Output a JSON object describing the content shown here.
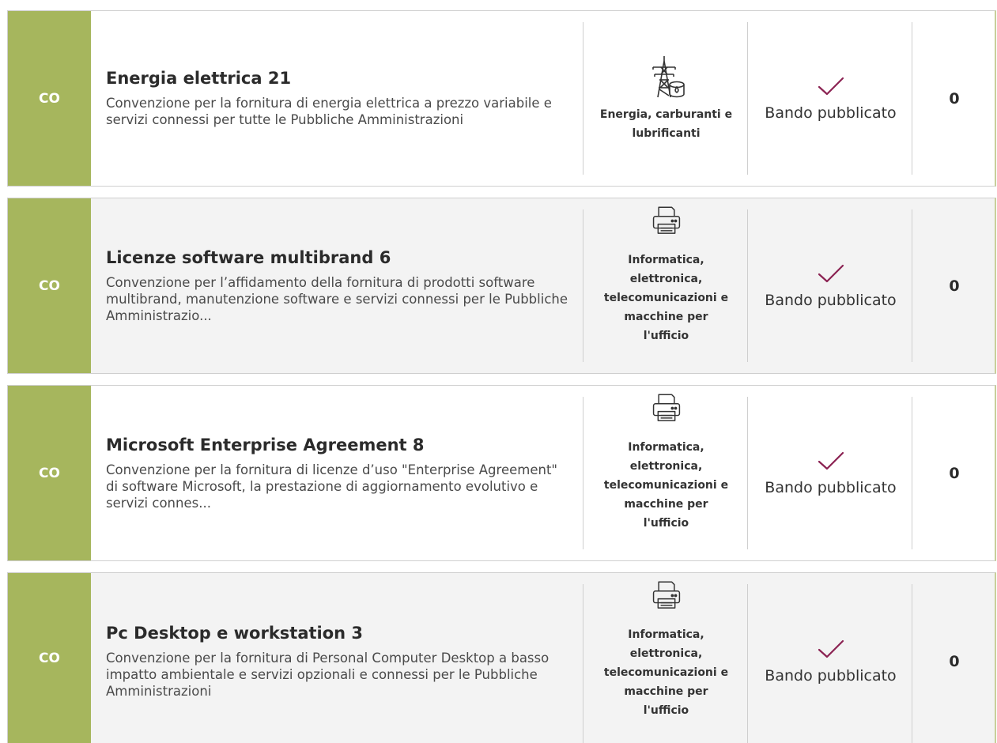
{
  "colors": {
    "type_badge": "#a6b65d",
    "check": "#8b2252"
  },
  "items": [
    {
      "type": "CO",
      "title": "Energia elettrica 21",
      "description": "Convenzione per la fornitura di energia elettrica a prezzo variabile e servizi connessi per tutte le Pubbliche Amministrazioni",
      "category_icon": "power-pylon-icon",
      "category": "Energia, carburanti e lubrificanti",
      "status": "Bando pubblicato",
      "count": "0"
    },
    {
      "type": "CO",
      "title": "Licenze software multibrand 6",
      "description": "Convenzione per l’affidamento della fornitura di prodotti software multibrand, manutenzione software e servizi connessi per le Pubbliche Amministrazio...",
      "category_icon": "printer-icon",
      "category": "Informatica, elettronica, telecomunicazioni e macchine per l'ufficio",
      "status": "Bando pubblicato",
      "count": "0"
    },
    {
      "type": "CO",
      "title": "Microsoft Enterprise Agreement 8",
      "description": "Convenzione per la fornitura di licenze d’uso \"Enterprise Agreement\" di software Microsoft, la prestazione di aggiornamento evolutivo e servizi connes...",
      "category_icon": "printer-icon",
      "category": "Informatica, elettronica, telecomunicazioni e macchine per l'ufficio",
      "status": "Bando pubblicato",
      "count": "0"
    },
    {
      "type": "CO",
      "title": "Pc Desktop e workstation 3",
      "description": "Convenzione per la fornitura di Personal Computer Desktop a basso impatto ambientale e servizi opzionali e connessi per le Pubbliche Amministrazioni",
      "category_icon": "printer-icon",
      "category": "Informatica, elettronica, telecomunicazioni e macchine per l'ufficio",
      "status": "Bando pubblicato",
      "count": "0"
    }
  ]
}
